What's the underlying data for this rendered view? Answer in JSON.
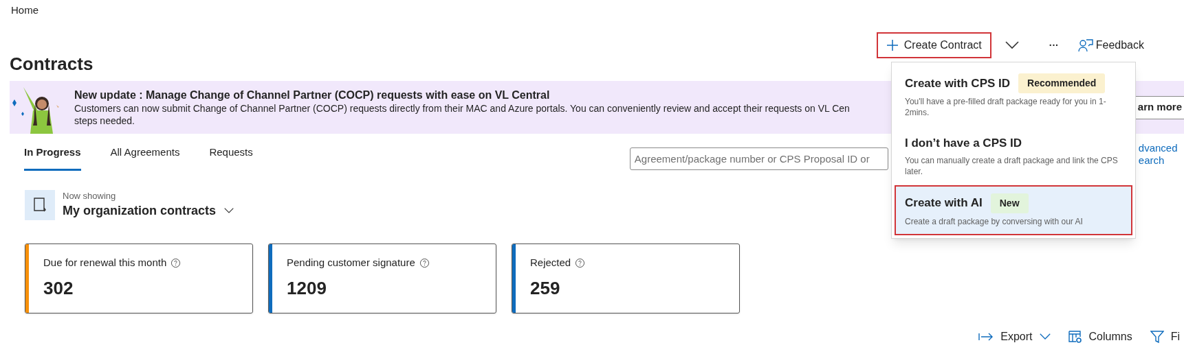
{
  "breadcrumb": "Home",
  "title": "Contracts",
  "toolbar": {
    "create": {
      "label": "Create Contract",
      "highlighted": true
    },
    "more": "···",
    "feedback": "Feedback"
  },
  "banner": {
    "heading": "New update : Manage Change of Channel Partner (COCP) requests with ease on VL Central",
    "lines": [
      "Customers can now submit Change of Channel Partner (COCP) requests directly from their MAC and Azure portals. You can conveniently review and accept their requests on VL Cen",
      "steps needed."
    ],
    "button": "arn more"
  },
  "tabs": [
    {
      "label": "In Progress",
      "selected": true
    },
    {
      "label": "All Agreements",
      "selected": false
    },
    {
      "label": "Requests",
      "selected": false
    }
  ],
  "search": {
    "placeholder": "Agreement/package number or CPS Proposal ID or"
  },
  "advanced_search": "dvanced earch",
  "now_showing": {
    "caption": "Now showing",
    "value": "My organization contracts"
  },
  "cards": [
    {
      "title": "Due for renewal this month",
      "value": "302",
      "color": "#f7900a"
    },
    {
      "title": "Pending customer signature",
      "value": "1209",
      "color": "#0f6cbd"
    },
    {
      "title": "Rejected",
      "value": "259",
      "color": "#0f6cbd"
    }
  ],
  "table_toolbar": [
    {
      "kind": "export",
      "label": "Export"
    },
    {
      "kind": "columns",
      "label": "Columns"
    },
    {
      "kind": "filter",
      "label": "Fi"
    }
  ],
  "menu": [
    {
      "title": "Create with CPS ID",
      "badge": {
        "text": "Recommended",
        "color": "#fbf1cf"
      },
      "description": "You'll have a pre-filled draft package ready for you in 1-2mins.",
      "selected": false,
      "highlighted": false
    },
    {
      "title": "I don’t have a CPS ID",
      "description": "You can manually create a draft package and link the CPS later.",
      "selected": false,
      "highlighted": false
    },
    {
      "title": "Create with AI",
      "badge": {
        "text": "New",
        "color": "#e2f4dc"
      },
      "description": "Create a draft package by conversing with our AI",
      "selected": true,
      "highlighted": true
    }
  ]
}
